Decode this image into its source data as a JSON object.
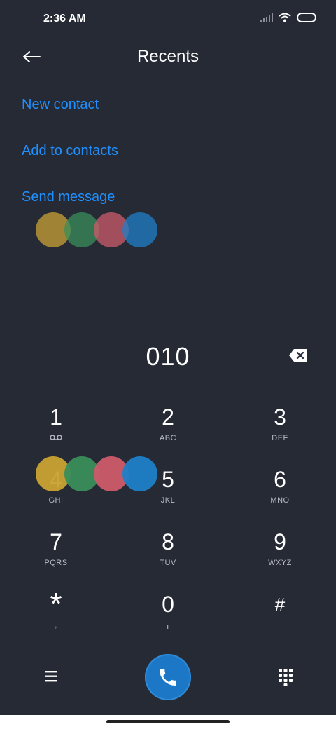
{
  "status": {
    "time": "2:36 AM"
  },
  "header": {
    "title": "Recents"
  },
  "actions": [
    {
      "label": "New contact"
    },
    {
      "label": "Add to contacts"
    },
    {
      "label": "Send message"
    }
  ],
  "dialer": {
    "number": "010",
    "keys": [
      {
        "digit": "1",
        "letters": ""
      },
      {
        "digit": "2",
        "letters": "ABC"
      },
      {
        "digit": "3",
        "letters": "DEF"
      },
      {
        "digit": "4",
        "letters": "GHI"
      },
      {
        "digit": "5",
        "letters": "JKL"
      },
      {
        "digit": "6",
        "letters": "MNO"
      },
      {
        "digit": "7",
        "letters": "PQRS"
      },
      {
        "digit": "8",
        "letters": "TUV"
      },
      {
        "digit": "9",
        "letters": "WXYZ"
      },
      {
        "digit": "*",
        "letters": ","
      },
      {
        "digit": "0",
        "letters": "+"
      },
      {
        "digit": "#",
        "letters": ""
      }
    ]
  },
  "icons": {
    "back": "arrow-left-icon",
    "backspace": "backspace-icon",
    "voicemail": "voicemail-icon",
    "menu": "menu-icon",
    "call": "phone-icon",
    "dialpad": "dialpad-icon"
  },
  "colors": {
    "background": "#262a35",
    "accent": "#1e90ff",
    "call_button": "#1c78c6",
    "dots": [
      "#c9a234",
      "#3a8d5b",
      "#cc5b6a",
      "#1f7fc7"
    ]
  }
}
